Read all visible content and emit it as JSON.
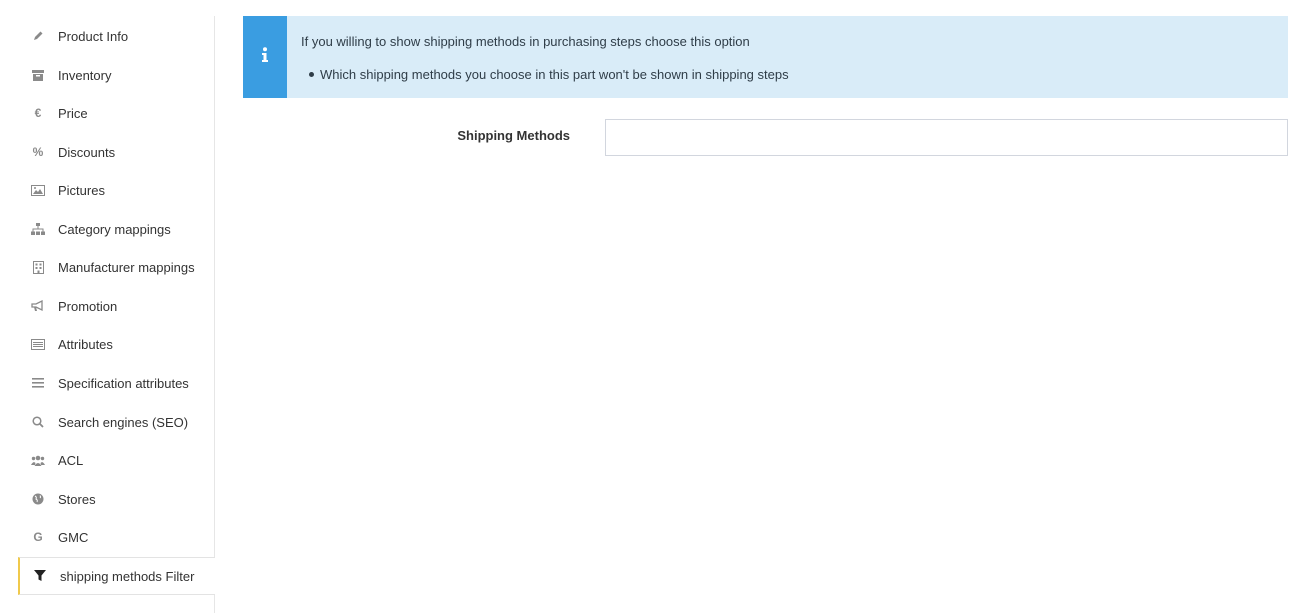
{
  "sidebar": {
    "items": [
      {
        "label": "Product Info",
        "icon": "pencil-icon"
      },
      {
        "label": "Inventory",
        "icon": "archive-icon"
      },
      {
        "label": "Price",
        "icon": "euro-icon"
      },
      {
        "label": "Discounts",
        "icon": "percent-icon"
      },
      {
        "label": "Pictures",
        "icon": "picture-icon"
      },
      {
        "label": "Category mappings",
        "icon": "sitemap-icon"
      },
      {
        "label": "Manufacturer mappings",
        "icon": "building-icon"
      },
      {
        "label": "Promotion",
        "icon": "bullhorn-icon"
      },
      {
        "label": "Attributes",
        "icon": "list-alt-icon"
      },
      {
        "label": "Specification attributes",
        "icon": "bars-icon"
      },
      {
        "label": "Search engines (SEO)",
        "icon": "search-icon"
      },
      {
        "label": "ACL",
        "icon": "users-icon"
      },
      {
        "label": "Stores",
        "icon": "globe-icon"
      },
      {
        "label": "GMC",
        "icon": "google-icon"
      },
      {
        "label": "shipping methods Filter",
        "icon": "filter-icon"
      }
    ],
    "active_index": 14,
    "active_accent": "#f0c94b"
  },
  "alert": {
    "icon": "info-icon",
    "message": "If you willing to show shipping methods in purchasing steps choose this option",
    "bullet": "Which shipping methods you choose in this part won't be shown in shipping steps",
    "background": "#d9ecf8",
    "icon_background": "#3a9de1"
  },
  "form": {
    "shipping_methods_label": "Shipping Methods",
    "shipping_methods_value": ""
  }
}
